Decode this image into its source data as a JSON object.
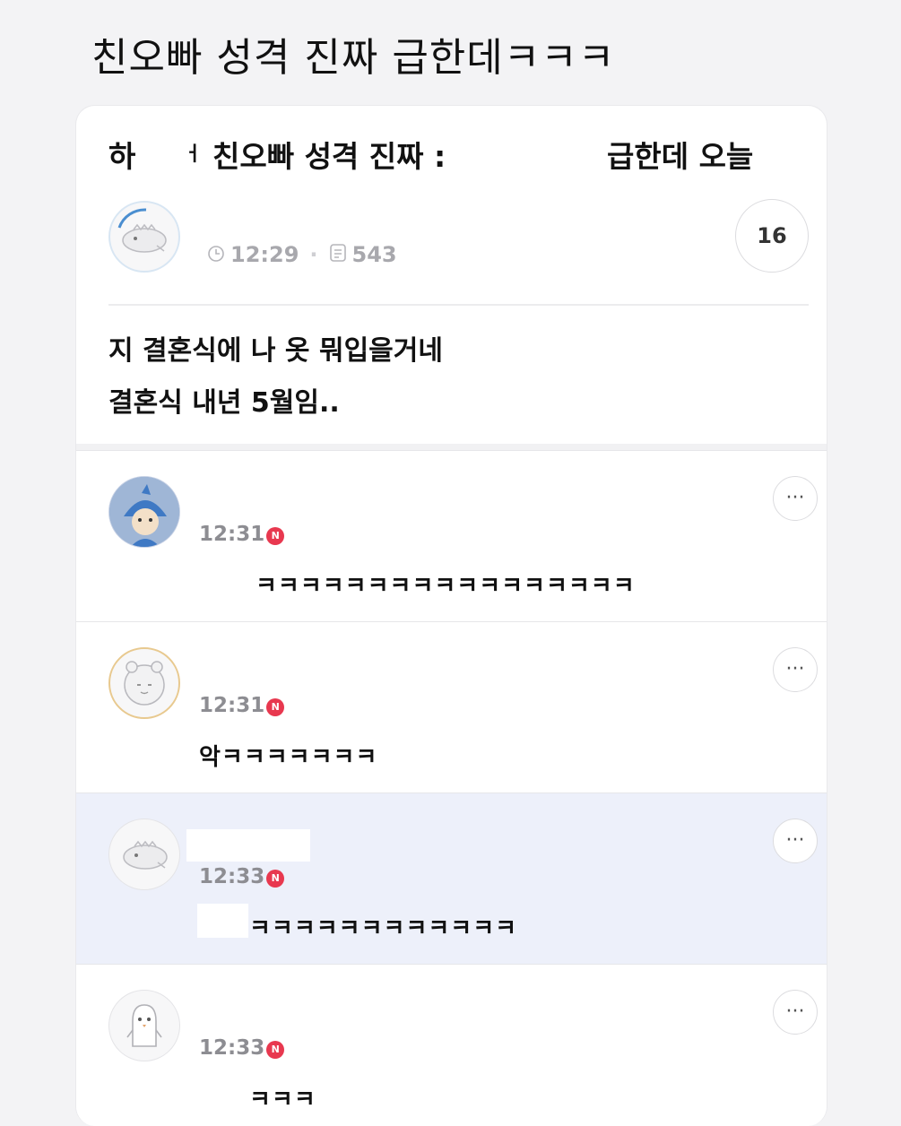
{
  "headline": "친오빠 성격 진짜 급한데ㅋㅋㅋ",
  "post": {
    "title_left_1": "하",
    "title_left_2": "ㅓ",
    "title_mid": "친오빠 성격 진짜 :",
    "title_right": "급한데 오늘",
    "time": "12:29",
    "views": "543",
    "comment_count": "16",
    "body_line1": "지 결혼식에 나 옷 뭐입을거네",
    "body_line2": "결혼식 내년 5월임.."
  },
  "comments": [
    {
      "time": "12:31",
      "badge": "N",
      "text": "ㅋㅋㅋㅋㅋㅋㅋㅋㅋㅋㅋㅋㅋㅋㅋㅋㅋ",
      "more": "···"
    },
    {
      "time": "12:31",
      "badge": "N",
      "text": "악ㅋㅋㅋㅋㅋㅋㅋ",
      "more": "···"
    },
    {
      "time": "12:33",
      "badge": "N",
      "text": "ㅋㅋㅋㅋㅋㅋㅋㅋㅋㅋㅋㅋ",
      "more": "···"
    },
    {
      "time": "12:33",
      "badge": "N",
      "text": "ㅋㅋㅋ",
      "more": "···"
    }
  ],
  "icons": {
    "clock": "clock-icon",
    "views": "document-icon",
    "more": "more-icon",
    "new_badge": "new-badge"
  },
  "colors": {
    "new_badge": "#e8384f",
    "highlight_row": "#edf0fa",
    "meta_text": "#a8a8ad"
  }
}
